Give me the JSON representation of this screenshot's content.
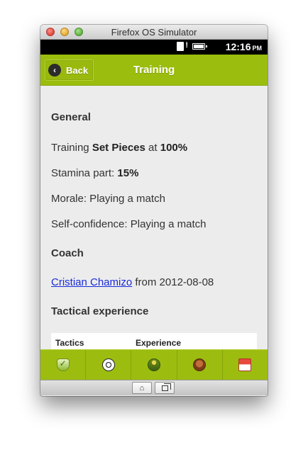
{
  "window": {
    "title": "Firefox OS Simulator"
  },
  "statusbar": {
    "time": "12:16",
    "ampm": "PM"
  },
  "header": {
    "back_label": "Back",
    "title": "Training"
  },
  "content": {
    "general_heading": "General",
    "training_prefix": "Training",
    "training_focus": "Set Pieces",
    "training_at": "at",
    "training_intensity": "100%",
    "stamina_label": "Stamina part:",
    "stamina_value": "15%",
    "morale": "Morale: Playing a match",
    "self_confidence": "Self-confidence: Playing a match",
    "coach_heading": "Coach",
    "coach_name": "Cristian Chamizo",
    "coach_since": "from 2012-08-08",
    "tactical_heading": "Tactical experience",
    "table_headers": [
      "Tactics",
      "Experience"
    ]
  },
  "tabs": [
    {
      "icon": "shield-check-icon"
    },
    {
      "icon": "soccer-ball-icon"
    },
    {
      "icon": "player-icon"
    },
    {
      "icon": "trophy-icon"
    },
    {
      "icon": "home-icon"
    }
  ]
}
